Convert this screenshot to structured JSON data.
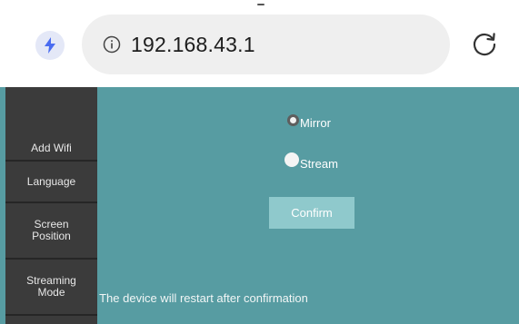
{
  "browser": {
    "url": "192.168.43.1",
    "icons": {
      "left": "lightning-bolt-icon",
      "info": "info-circle-icon",
      "reload": "reload-icon"
    },
    "colors": {
      "bolt": "#4a6cf0",
      "bar": "#efefef"
    }
  },
  "sidebar": {
    "items": [
      {
        "label": "Add Wifi"
      },
      {
        "label": "Language"
      },
      {
        "label": "Screen Position"
      },
      {
        "label": "Streaming Mode"
      }
    ]
  },
  "form": {
    "options": [
      {
        "label": "Mirror",
        "selected": false
      },
      {
        "label": "Stream",
        "selected": true
      }
    ],
    "confirm_label": "Confirm",
    "note": "The device will restart after confirmation"
  },
  "colors": {
    "page_bg": "#579ca2",
    "sidebar_bg": "#3b3b3b",
    "button_bg": "#8fc9cc"
  }
}
